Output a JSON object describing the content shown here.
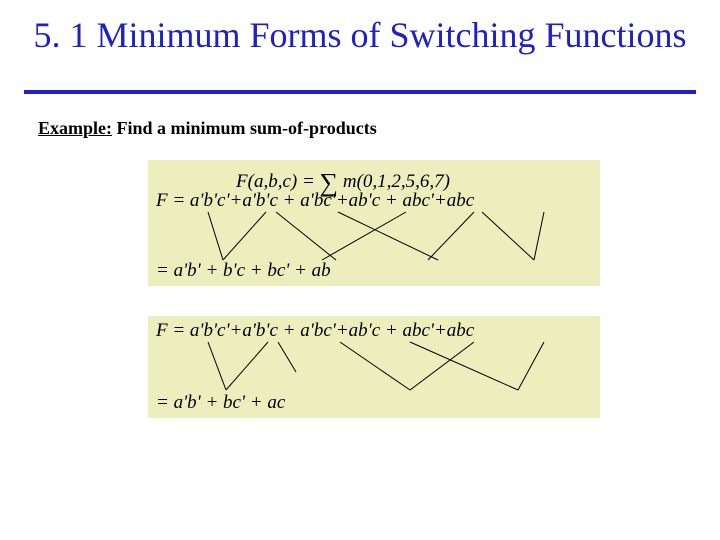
{
  "title": "5. 1  Minimum Forms of Switching Functions",
  "example": {
    "lead": "Example:",
    "rest": " Find a minimum sum-of-products"
  },
  "block1": {
    "def": "F(a,b,c) = ∑ m(0,1,2,5,6,7)",
    "expanded": "F = a'b'c'+a'b'c + a'bc'+ab'c + abc'+abc",
    "reduced": "=     a'b'      +      b'c     +     bc'     +      ab"
  },
  "block2": {
    "expanded": "F = a'b'c'+a'b'c + a'bc'+ab'c + abc'+abc",
    "reduced": "=     a'b'             +          bc'         +       ac"
  }
}
